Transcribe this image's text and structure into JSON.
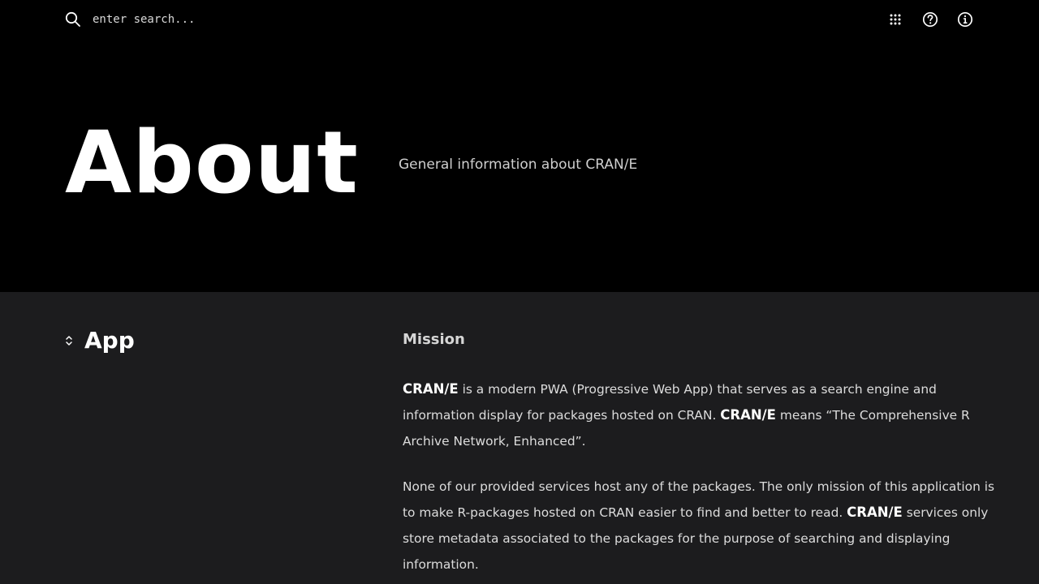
{
  "search": {
    "placeholder": "enter search..."
  },
  "header_icons": [
    "apps-grid-icon",
    "help-circle-icon",
    "info-circle-icon"
  ],
  "hero": {
    "title": "About",
    "subtitle": "General information about CRAN/E"
  },
  "section": {
    "title": "App"
  },
  "mission": {
    "heading": "Mission",
    "brand": "CRAN/E",
    "p1_a": " is a modern PWA (Progressive Web App) that serves as a search engine and information display for packages hosted on CRAN. ",
    "p1_b": " means “The Comprehensive R Archive Network, Enhanced”.",
    "p2_a": "None of our provided services host any of the packages. The only mission of this application is to make R-packages hosted on CRAN easier to find and better to read. ",
    "p2_b": " services only store metadata associated to the packages for the purpose of searching and displaying information."
  },
  "colors": {
    "hero_bg": "#000000",
    "content_bg": "#1c1c1e",
    "text": "#dcdcdc",
    "heading": "#ffffff"
  }
}
